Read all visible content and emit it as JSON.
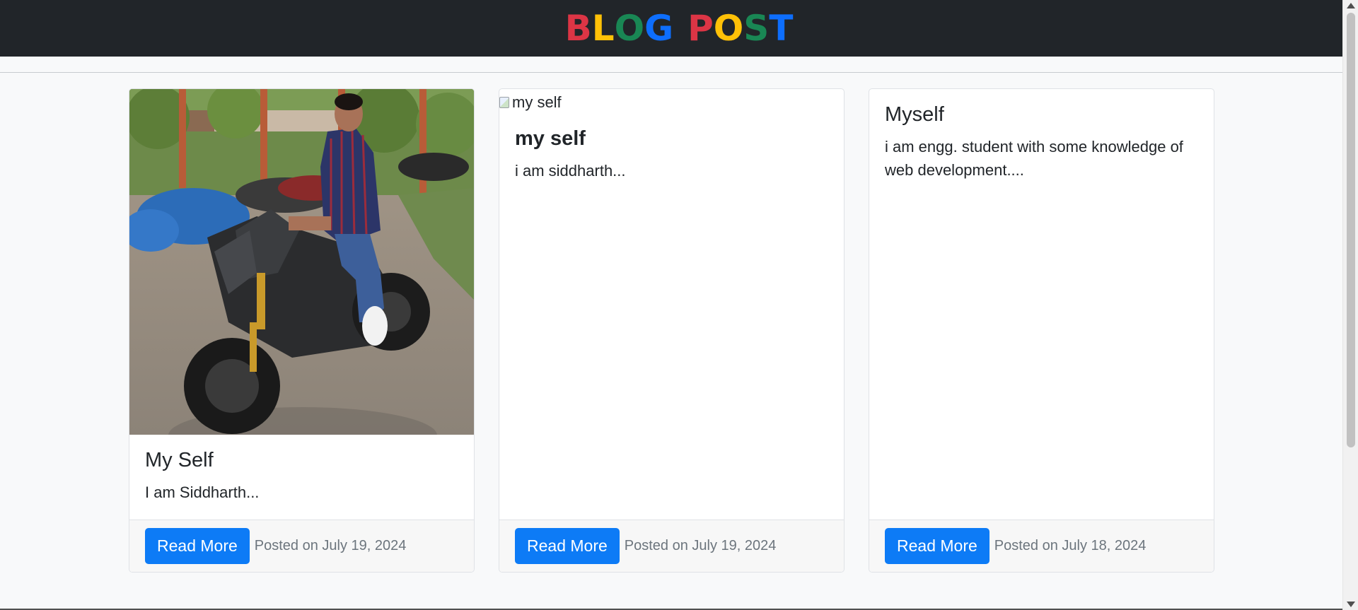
{
  "navbar": {
    "brand_letters": [
      {
        "ch": "B",
        "color": "#dc3545"
      },
      {
        "ch": "L",
        "color": "#ffc107"
      },
      {
        "ch": "O",
        "color": "#198754"
      },
      {
        "ch": "G",
        "color": "#0d6efd"
      },
      {
        "ch": " ",
        "color": "#ffffff"
      },
      {
        "ch": "P",
        "color": "#dc3545"
      },
      {
        "ch": "O",
        "color": "#ffc107"
      },
      {
        "ch": "S",
        "color": "#198754"
      },
      {
        "ch": "T",
        "color": "#0d6efd"
      }
    ]
  },
  "posts": [
    {
      "image_alt": "my self",
      "image_loaded": true,
      "title": "My Self",
      "excerpt": "I am Siddharth...",
      "button_label": "Read More",
      "posted": "Posted on July 19, 2024"
    },
    {
      "image_alt": "my self",
      "image_loaded": false,
      "title": "my self",
      "excerpt": "i am siddharth...",
      "button_label": "Read More",
      "posted": "Posted on July 19, 2024"
    },
    {
      "image_alt": "",
      "image_loaded": null,
      "title": "Myself",
      "excerpt": "i am engg. student with some knowledge of web development....",
      "button_label": "Read More",
      "posted": "Posted on July 18, 2024"
    }
  ],
  "colors": {
    "navbar_bg": "#212529",
    "button_bg": "#0d7bf6",
    "page_bg": "#f8f9fa"
  }
}
